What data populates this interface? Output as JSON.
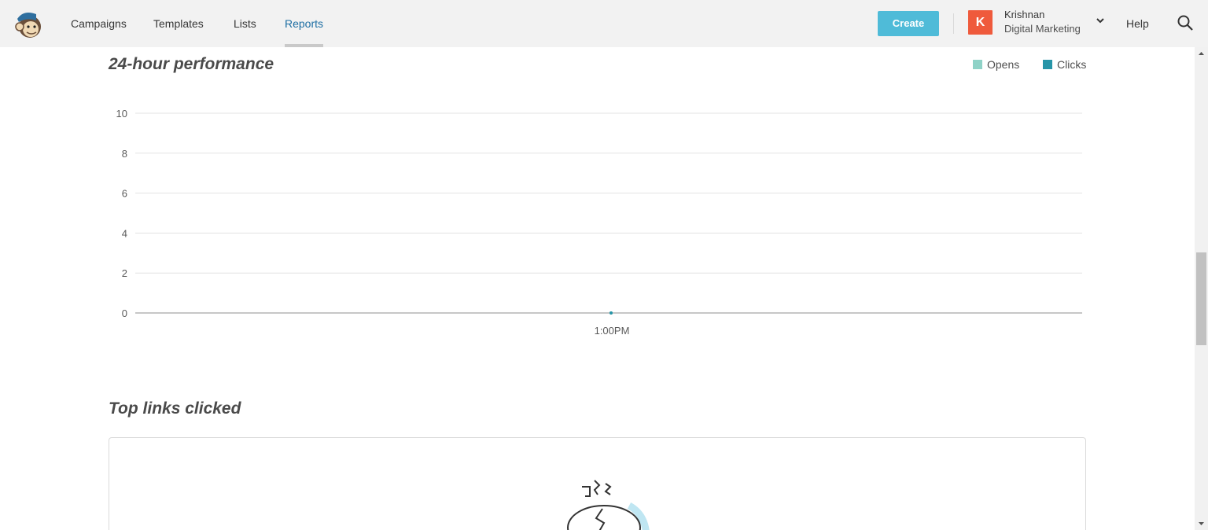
{
  "nav": {
    "items": [
      {
        "label": "Campaigns",
        "active": false
      },
      {
        "label": "Templates",
        "active": false
      },
      {
        "label": "Lists",
        "active": false
      },
      {
        "label": "Reports",
        "active": true
      }
    ]
  },
  "header": {
    "create_label": "Create",
    "account": {
      "initial": "K",
      "name": "Krishnan",
      "org": "Digital Marketing"
    },
    "help_label": "Help"
  },
  "colors": {
    "accent": "#4fbbd8",
    "active_nav": "#1d6ea3",
    "avatar": "#ef5a3c",
    "opens": "#8fd2c7",
    "clicks": "#2795a8"
  },
  "performance": {
    "title": "24-hour performance",
    "legend": {
      "opens": "Opens",
      "clicks": "Clicks"
    }
  },
  "chart_data": {
    "type": "line",
    "x": [
      "1:00PM"
    ],
    "series": [
      {
        "name": "Opens",
        "values": [
          0
        ]
      },
      {
        "name": "Clicks",
        "values": [
          0
        ]
      }
    ],
    "yticks": [
      0,
      2,
      4,
      6,
      8,
      10
    ],
    "ylim": [
      0,
      10
    ],
    "grid": true,
    "legend_position": "top-right"
  },
  "top_links": {
    "title": "Top links clicked"
  }
}
